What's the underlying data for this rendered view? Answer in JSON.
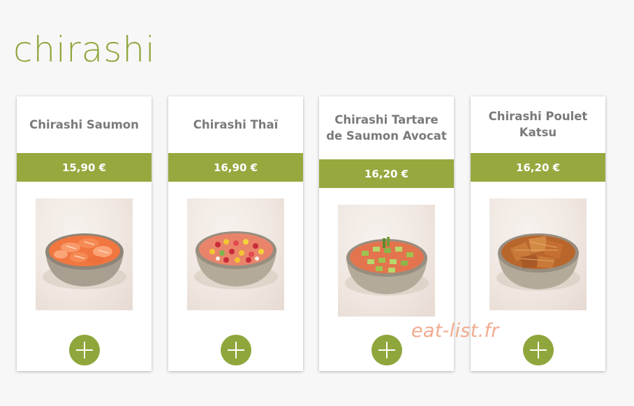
{
  "section": {
    "title": "chirashi"
  },
  "products": [
    {
      "name": "Chirashi Saumon",
      "price": "15,90 €",
      "icon": "plus-icon"
    },
    {
      "name": "Chirashi Thaï",
      "price": "16,90 €",
      "icon": "plus-icon"
    },
    {
      "name": "Chirashi Tartare de Saumon Avocat",
      "price": "16,20 €",
      "icon": "plus-icon"
    },
    {
      "name": "Chirashi Poulet Katsu",
      "price": "16,20 €",
      "icon": "plus-icon"
    }
  ],
  "watermark": "eat-list.fr",
  "colors": {
    "accent": "#97a83f",
    "title": "#8fa63c",
    "button": "#8fa63c",
    "name_text": "#7a7a7a",
    "background": "#f7f7f7"
  }
}
